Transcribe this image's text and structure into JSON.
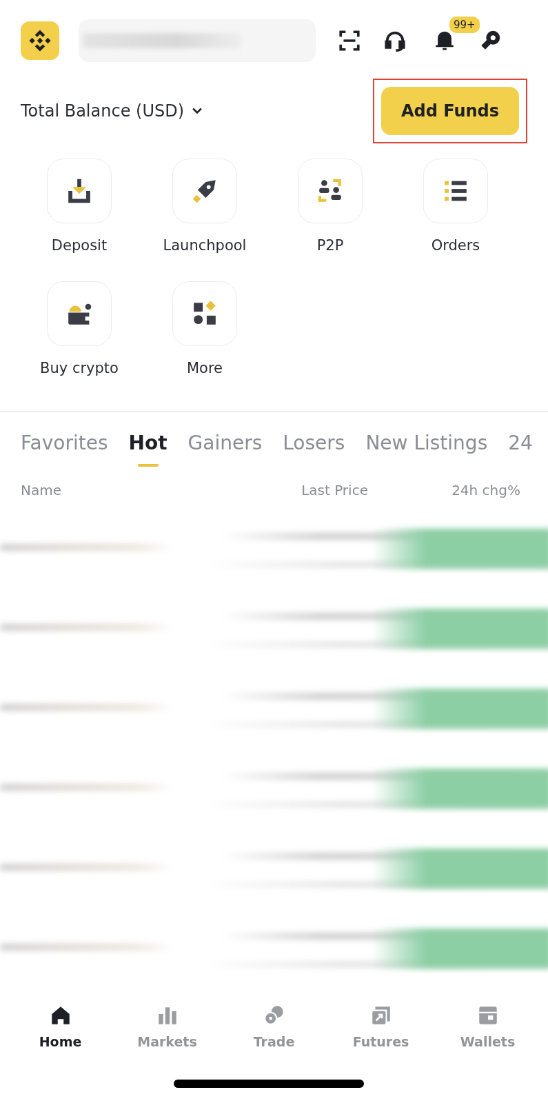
{
  "header": {
    "notification_badge": "99+"
  },
  "balance": {
    "label": "Total Balance (USD)",
    "add_funds": {
      "label": "Add Funds",
      "highlighted": true
    }
  },
  "shortcuts": [
    {
      "label": "Deposit",
      "kind": "deposit"
    },
    {
      "label": "Launchpool",
      "kind": "rocket"
    },
    {
      "label": "P2P",
      "kind": "p2p"
    },
    {
      "label": "Orders",
      "kind": "orders"
    },
    {
      "label": "Buy crypto",
      "kind": "wallet"
    },
    {
      "label": "More",
      "kind": "more"
    }
  ],
  "market_tabs": [
    {
      "label": "Favorites",
      "selected": false
    },
    {
      "label": "Hot",
      "selected": true
    },
    {
      "label": "Gainers",
      "selected": false
    },
    {
      "label": "Losers",
      "selected": false
    },
    {
      "label": "New Listings",
      "selected": false
    },
    {
      "label": "24",
      "selected": false
    }
  ],
  "table": {
    "columns": [
      "Name",
      "Last Price",
      "24h chg%"
    ],
    "rows": [
      {
        "kind": "blurred"
      },
      {
        "kind": "blurred"
      },
      {
        "kind": "blurred"
      },
      {
        "kind": "blurred"
      },
      {
        "kind": "blurred"
      },
      {
        "kind": "blurred"
      }
    ]
  },
  "bottom_nav": [
    {
      "label": "Home",
      "kind": "home",
      "selected": true
    },
    {
      "label": "Markets",
      "kind": "markets",
      "selected": false
    },
    {
      "label": "Trade",
      "kind": "trade",
      "selected": false
    },
    {
      "label": "Futures",
      "kind": "futures",
      "selected": false
    },
    {
      "label": "Wallets",
      "kind": "wallets",
      "selected": false
    }
  ]
}
